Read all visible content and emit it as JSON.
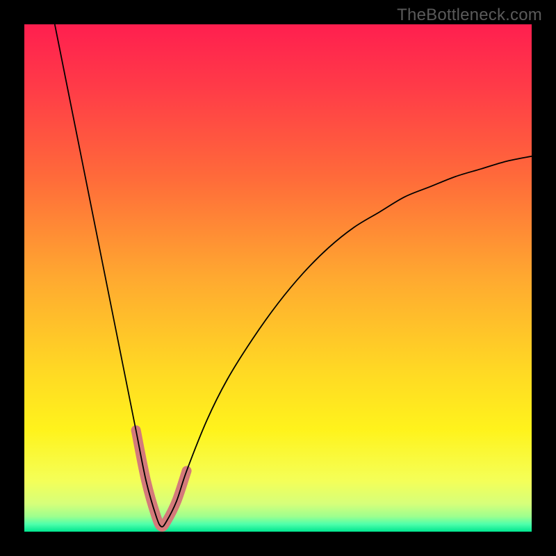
{
  "watermark": "TheBottleneck.com",
  "chart_data": {
    "type": "line",
    "title": "",
    "xlabel": "",
    "ylabel": "",
    "xlim": [
      0,
      100
    ],
    "ylim": [
      0,
      100
    ],
    "description": "Bottleneck curve: V-shape showing performance mismatch. Minimum (optimal balance) around x=27. Left branch starts at (6,100), drops to minimum near (27,1), right branch rises to about (100,74). Green band at very bottom indicates optimal balanced zone; gradient from red (top) through orange, yellow to green (bottom) indicates severity of bottleneck.",
    "series": [
      {
        "name": "bottleneck-curve",
        "x": [
          6,
          10,
          14,
          18,
          20,
          22,
          24,
          26,
          27,
          28,
          30,
          32,
          36,
          40,
          45,
          50,
          55,
          60,
          65,
          70,
          75,
          80,
          85,
          90,
          95,
          100
        ],
        "y": [
          100,
          80,
          60,
          40,
          30,
          20,
          10,
          3,
          1,
          2,
          6,
          12,
          22,
          30,
          38,
          45,
          51,
          56,
          60,
          63,
          66,
          68,
          70,
          71.5,
          73,
          74
        ]
      }
    ],
    "highlight": {
      "x": [
        22,
        24,
        26,
        27,
        28,
        30,
        32
      ],
      "y": [
        20,
        10,
        3,
        1,
        2,
        6,
        12
      ],
      "color": "#d47a7a",
      "width": 14
    },
    "gradient_stops": [
      {
        "offset": 0.0,
        "color": "#ff1f4f"
      },
      {
        "offset": 0.12,
        "color": "#ff3a48"
      },
      {
        "offset": 0.3,
        "color": "#ff6a3a"
      },
      {
        "offset": 0.5,
        "color": "#ffa930"
      },
      {
        "offset": 0.68,
        "color": "#ffd824"
      },
      {
        "offset": 0.8,
        "color": "#fff31c"
      },
      {
        "offset": 0.9,
        "color": "#f4ff58"
      },
      {
        "offset": 0.945,
        "color": "#d6ff7a"
      },
      {
        "offset": 0.97,
        "color": "#9eff8e"
      },
      {
        "offset": 0.985,
        "color": "#4fffab"
      },
      {
        "offset": 1.0,
        "color": "#00e68f"
      }
    ]
  }
}
